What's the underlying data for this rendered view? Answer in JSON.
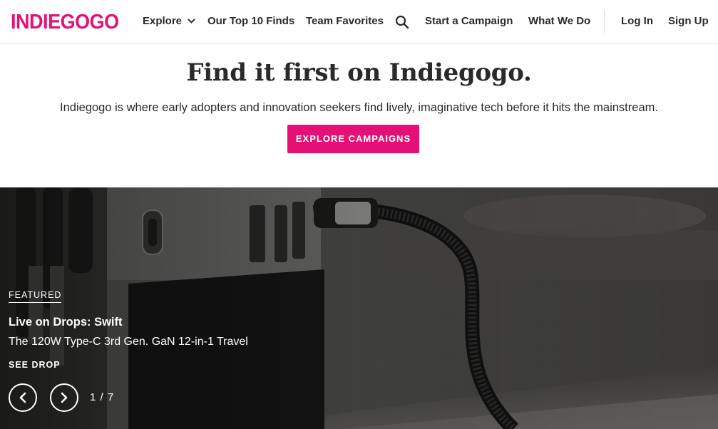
{
  "header": {
    "logo": "INDIEGOGO",
    "nav": {
      "explore": "Explore",
      "top10": "Our Top 10 Finds",
      "team_favorites": "Team Favorites",
      "search_icon": "search-icon",
      "start_campaign": "Start a Campaign",
      "what_we_do": "What We Do",
      "log_in": "Log In",
      "sign_up": "Sign Up"
    }
  },
  "hero": {
    "title": "Find it first on Indiegogo.",
    "subtitle": "Indiegogo is where early adopters and innovation seekers find lively, imaginative tech before it hits the mainstream.",
    "cta_label": "EXPLORE CAMPAIGNS"
  },
  "featured": {
    "tag": "FEATURED",
    "title": "Live on Drops: Swift",
    "description": "The 120W Type-C 3rd Gen. GaN 12-in-1 Travel",
    "link_label": "SEE DROP",
    "pager": "1 / 7",
    "prev_icon": "chevron-left-icon",
    "next_icon": "chevron-right-icon"
  },
  "colors": {
    "brand": "#e51075",
    "text": "#2a2a2a"
  }
}
